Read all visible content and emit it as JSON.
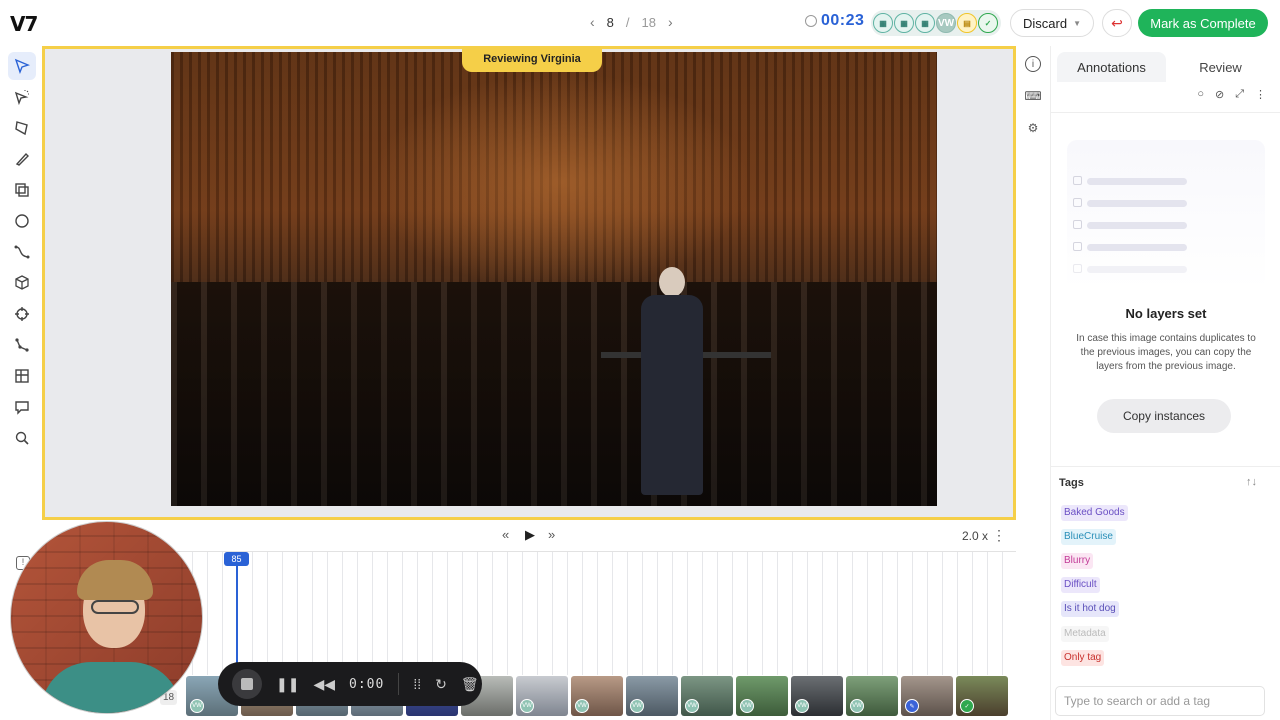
{
  "header": {
    "logo": "V7",
    "pager": {
      "current": "8",
      "separator": "/",
      "total": "18"
    },
    "timer": "00:23",
    "stages": [
      {
        "label": "",
        "icon": "grid-icon"
      },
      {
        "label": "",
        "icon": "grid-icon"
      },
      {
        "label": "",
        "icon": "grid-icon"
      },
      {
        "label": "VW",
        "icon": ""
      },
      {
        "label": "",
        "icon": "review-icon"
      },
      {
        "label": "",
        "icon": "check-icon"
      }
    ],
    "discard_label": "Discard",
    "complete_label": "Mark as Complete"
  },
  "canvas": {
    "banner": "Reviewing Virginia"
  },
  "player": {
    "speed": "2.0 x",
    "playhead_frame": "85",
    "frame_count_badge": "18"
  },
  "recorder": {
    "time": "0:00"
  },
  "panel": {
    "tabs": [
      "Annotations",
      "Review"
    ],
    "empty_title": "No layers set",
    "empty_desc": "In case this image contains duplicates to the previous images, you can copy the layers from the previous image.",
    "copy_button": "Copy instances",
    "tags_title": "Tags",
    "tags": [
      {
        "label": "Baked Goods",
        "color": "#6a4fc4",
        "bg": "#ece7fb"
      },
      {
        "label": "BlueCruise",
        "color": "#2a8fb8",
        "bg": "#e3f3fa"
      },
      {
        "label": "Blurry",
        "color": "#c23a97",
        "bg": "#fbe6f3"
      },
      {
        "label": "Difficult",
        "color": "#6a4fc4",
        "bg": "#ece7fb"
      },
      {
        "label": "Is it hot dog",
        "color": "#5a4fb8",
        "bg": "#e6e6fa"
      },
      {
        "label": "Metadata",
        "color": "#bbbbbb",
        "bg": "#f6f6f6"
      },
      {
        "label": "Only tag",
        "color": "#c8322e",
        "bg": "#fde4e2"
      }
    ],
    "tag_placeholder": "Type to search or add a tag"
  }
}
